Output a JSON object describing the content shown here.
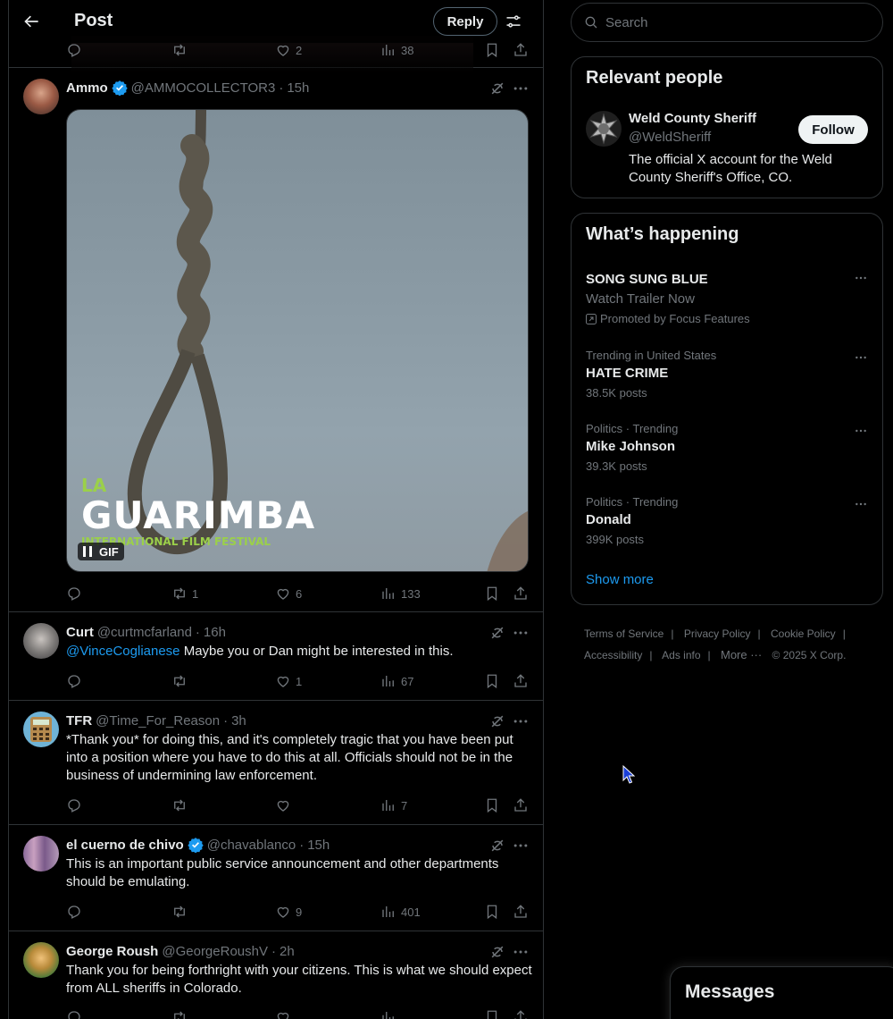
{
  "header": {
    "title": "Post",
    "reply_label": "Reply"
  },
  "previous_post": {
    "likes": "2",
    "views": "38"
  },
  "tweets": [
    {
      "name": "Ammo",
      "verified": true,
      "handle": "@AMMOCOLLECTOR3",
      "time": "15h",
      "media_badge": "GIF",
      "media_brand_line1": "LA",
      "media_brand_line2": "GUARIMBA",
      "media_brand_line3": "INTERNATIONAL FILM FESTIVAL",
      "replies": "",
      "reposts": "1",
      "likes": "6",
      "views": "133"
    },
    {
      "name": "Curt",
      "verified": false,
      "handle": "@curtmcfarland",
      "time": "16h",
      "mention": "@VinceCoglianese",
      "text": " Maybe you or Dan might be interested in this.",
      "replies": "",
      "reposts": "",
      "likes": "1",
      "views": "67"
    },
    {
      "name": "TFR",
      "verified": false,
      "handle": "@Time_For_Reason",
      "time": "3h",
      "text": "*Thank you* for doing this, and it's completely tragic that you have been put into a position where you have to do this at all. Officials should not be in the business of undermining law enforcement.",
      "replies": "",
      "reposts": "",
      "likes": "",
      "views": "7"
    },
    {
      "name": "el cuerno de chivo",
      "verified": true,
      "handle": "@chavablanco",
      "time": "15h",
      "text": "This is an important public service announcement and other departments should be emulating.",
      "replies": "",
      "reposts": "",
      "likes": "9",
      "views": "401"
    },
    {
      "name": "George Roush",
      "verified": false,
      "handle": "@GeorgeRoushV",
      "time": "2h",
      "text": "Thank you for being forthright with your citizens. This is what we should expect from ALL sheriffs in Colorado."
    }
  ],
  "search": {
    "placeholder": "Search"
  },
  "relevant_people": {
    "title": "Relevant people",
    "name": "Weld County Sheriff",
    "handle": "@WeldSheriff",
    "follow_label": "Follow",
    "bio": "The official X account for the Weld County Sheriff's Office, CO."
  },
  "whats_happening": {
    "title": "What’s happening",
    "promo": {
      "title": "SONG SUNG BLUE",
      "subtitle": "Watch Trailer Now",
      "promoted_by": "Promoted by Focus Features"
    },
    "trends": [
      {
        "meta": "Trending in United States",
        "title": "HATE CRIME",
        "count": "38.5K posts"
      },
      {
        "meta": "Politics · Trending",
        "title": "Mike Johnson",
        "count": "39.3K posts"
      },
      {
        "meta": "Politics · Trending",
        "title": "Donald",
        "count": "399K posts"
      }
    ],
    "show_more": "Show more"
  },
  "footer": {
    "terms": "Terms of Service",
    "privacy": "Privacy Policy",
    "cookie": "Cookie Policy",
    "accessibility": "Accessibility",
    "ads": "Ads info",
    "more": "More ···",
    "copyright": "© 2025 X Corp."
  },
  "messages": {
    "title": "Messages"
  },
  "colors": {
    "accent": "#1d9bf0",
    "background": "#000000",
    "border": "#2f3336",
    "muted": "#71767b"
  }
}
